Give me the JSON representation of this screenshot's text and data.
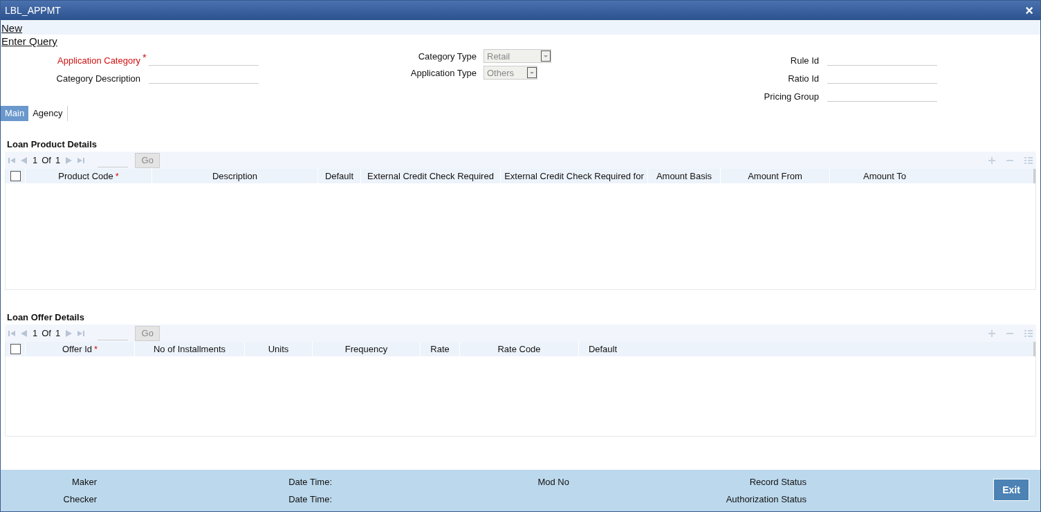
{
  "window": {
    "title": "LBL_APPMT",
    "close": "×"
  },
  "menu_links": [
    "New",
    "Enter Query"
  ],
  "fields_left": [
    {
      "label": "Application Category",
      "required": true,
      "mark": "*"
    },
    {
      "label": "Category Description",
      "required": false
    }
  ],
  "fields_middle": [
    {
      "label": "Category Type",
      "value": "Retail",
      "disabled": true
    },
    {
      "label": "Application Type",
      "value": "Others",
      "disabled": true
    }
  ],
  "fields_right": [
    {
      "label": "Rule Id"
    },
    {
      "label": "Ratio Id"
    },
    {
      "label": "Pricing Group"
    }
  ],
  "tabs": [
    {
      "label": "Main",
      "selected": true
    },
    {
      "label": "Agency",
      "selected": false
    }
  ],
  "grids": [
    {
      "title": "Loan Product Details",
      "pager": {
        "current": "1",
        "of": "Of",
        "total": "1"
      },
      "go": "Go",
      "checked": false,
      "columns": [
        {
          "label": "Product Code",
          "mark": "*"
        },
        {
          "label": "Description"
        },
        {
          "label": "Default"
        },
        {
          "label": "External Credit Check Required"
        },
        {
          "label": "External Credit Check Required for"
        },
        {
          "label": "Amount Basis"
        },
        {
          "label": "Amount From"
        },
        {
          "label": "Amount To"
        }
      ]
    },
    {
      "title": "Loan Offer Details",
      "pager": {
        "current": "1",
        "of": "Of",
        "total": "1"
      },
      "go": "Go",
      "checked": false,
      "columns": [
        {
          "label": "Offer Id",
          "mark": "*"
        },
        {
          "label": "No of Installments"
        },
        {
          "label": "Units"
        },
        {
          "label": "Frequency"
        },
        {
          "label": "Rate"
        },
        {
          "label": "Rate Code"
        },
        {
          "label": "Default"
        }
      ]
    }
  ],
  "footer": {
    "rows": [
      [
        "Maker",
        "Date Time:",
        "Mod No",
        "Record Status"
      ],
      [
        "Checker",
        "Date Time:",
        null,
        "Authorization Status"
      ]
    ],
    "exit": "Exit"
  }
}
